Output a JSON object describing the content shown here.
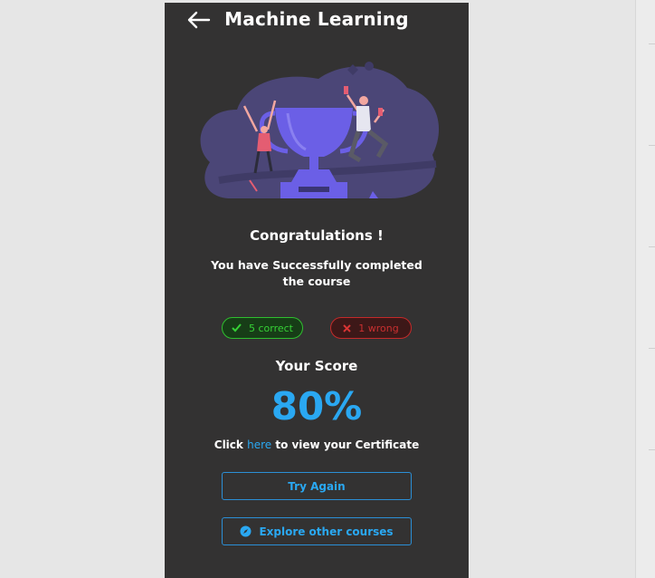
{
  "header": {
    "title": "Machine Learning",
    "back_icon": "arrow-left-icon"
  },
  "result": {
    "heading": "Congratulations !",
    "message": "You have Successfully completed the course",
    "correct_label": "5 correct",
    "wrong_label": "1 wrong",
    "score_label": "Your Score",
    "score_value": "80%"
  },
  "certificate": {
    "prefix": "Click",
    "link_text": "here",
    "suffix": "to view your Certificate"
  },
  "actions": {
    "try_again": "Try Again",
    "explore": "Explore other courses"
  },
  "colors": {
    "background": "#333232",
    "accent": "#2aa8f2",
    "correct": "#36d136",
    "wrong": "#c93030",
    "illustration": "#4b4677",
    "trophy": "#6b5fe6"
  }
}
